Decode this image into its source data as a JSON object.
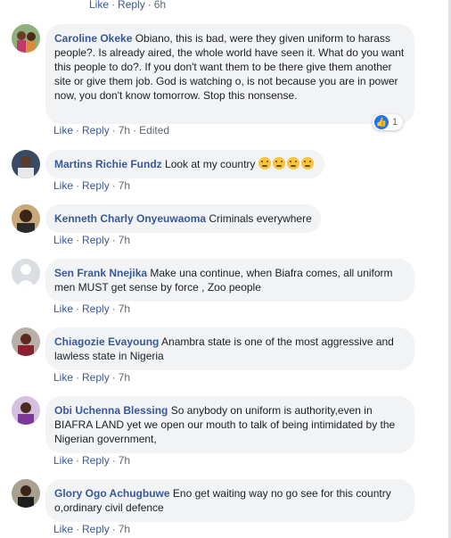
{
  "top_actions": {
    "like": "Like",
    "reply": "Reply",
    "time": "6h"
  },
  "reaction_count": "1",
  "comments": [
    {
      "name": "Caroline Okeke",
      "text": "Obiano, this is bad, were they given uniform to harass people?. Is already aired, the whole world have seen it. What do you want this people to do?. If you don't want them to be there give them another site or give them job. God is watching o, is not because you are in power now, you don't know tomorrow. Stop this nonsense.",
      "like": "Like",
      "reply": "Reply",
      "time": "7h",
      "edited": "Edited"
    },
    {
      "name": "Martins Richie Fundz",
      "text": "Look at my country",
      "like": "Like",
      "reply": "Reply",
      "time": "7h"
    },
    {
      "name": "Kenneth Charly Onyeuwaoma",
      "text": "Criminals everywhere",
      "like": "Like",
      "reply": "Reply",
      "time": "7h"
    },
    {
      "name": "Sen Frank Nnejika",
      "text": "Make una continue, when Biafra comes, all uniform men MUST get sense by force , Zoo people",
      "like": "Like",
      "reply": "Reply",
      "time": "7h"
    },
    {
      "name": "Chiagozie Evayoung",
      "text": "Anambra state is one of the most aggressive and lawless state in Nigeria",
      "like": "Like",
      "reply": "Reply",
      "time": "7h"
    },
    {
      "name": "Obi Uchenna Blessing",
      "text": "So anybody on uniform is authority,even in BIAFRA LAND yet we open our mouth to talk of being intimidated by the Nigerian government,",
      "like": "Like",
      "reply": "Reply",
      "time": "7h"
    },
    {
      "name": "Glory Ogo Achugbuwe",
      "text": "Eno get waiting way no go see for this country o,ordinary civil defence",
      "like": "Like",
      "reply": "Reply",
      "time": "7h"
    }
  ]
}
